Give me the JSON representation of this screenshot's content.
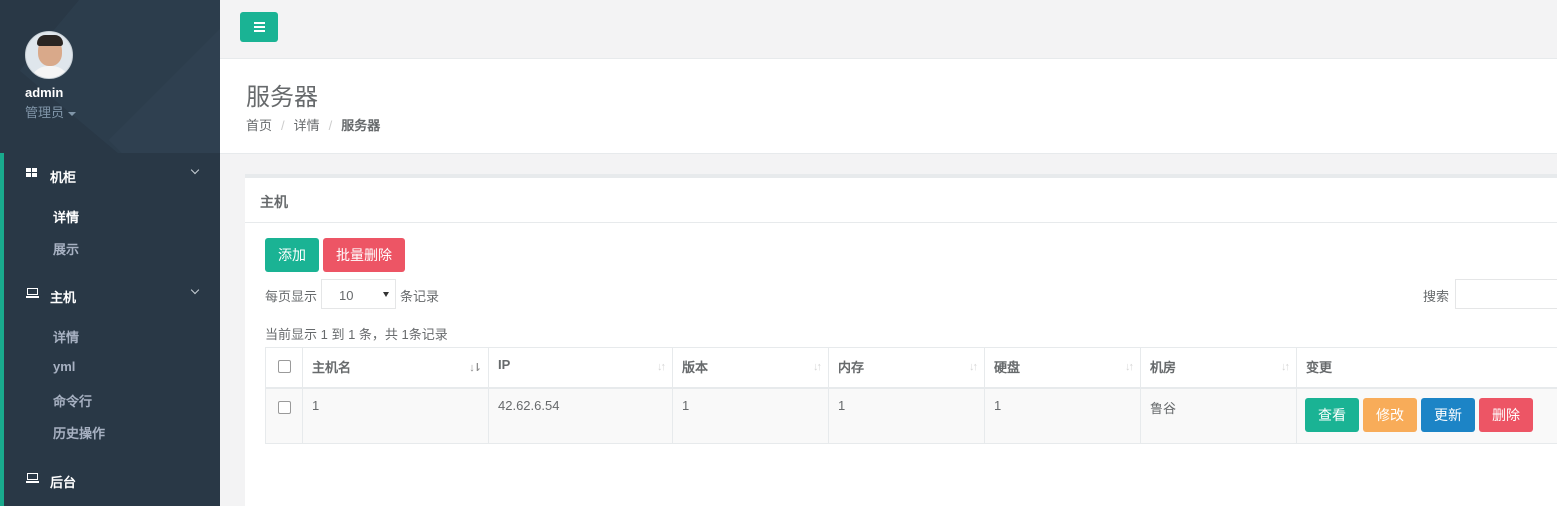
{
  "sidebar": {
    "username": "admin",
    "role": "管理员",
    "groups": [
      {
        "label": "机柜",
        "icon": "grid-icon",
        "items": [
          "详情",
          "展示"
        ]
      },
      {
        "label": "主机",
        "icon": "laptop-icon",
        "items": [
          "详情",
          "yml",
          "命令行",
          "历史操作"
        ]
      },
      {
        "label": "后台",
        "icon": "laptop-icon",
        "items": []
      }
    ]
  },
  "page": {
    "title": "服务器",
    "breadcrumb": [
      "首页",
      "详情",
      "服务器"
    ]
  },
  "panel": {
    "title": "主机",
    "add_label": "添加",
    "batch_delete_label": "批量删除",
    "per_page_prefix": "每页显示",
    "per_page_value": "10",
    "per_page_suffix": "条记录",
    "search_label": "搜索",
    "summary": "当前显示 1 到 1 条，共 1条记录"
  },
  "table": {
    "columns": [
      "主机名",
      "IP",
      "版本",
      "内存",
      "硬盘",
      "机房",
      "变更"
    ],
    "rows": [
      {
        "hostname": "1",
        "ip": "42.62.6.54",
        "version": "1",
        "memory": "1",
        "disk": "1",
        "room": "鲁谷"
      }
    ],
    "row_actions": [
      "查看",
      "修改",
      "更新",
      "删除"
    ]
  },
  "colors": {
    "primary": "#1ab394",
    "danger": "#ed5565",
    "warning": "#f8ac59",
    "info": "#1c84c6",
    "sidebar_bg": "#2f4050"
  }
}
